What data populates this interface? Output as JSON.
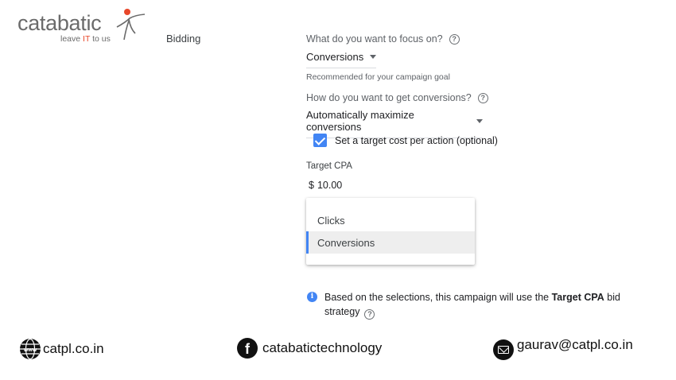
{
  "logo": {
    "word": "catabatic",
    "tagline_pre": "leave ",
    "tagline_it": "IT",
    "tagline_post": " to us"
  },
  "section": {
    "label": "Bidding"
  },
  "focus": {
    "question": "What do you want to focus on?",
    "value": "Conversions",
    "hint": "Recommended for your campaign goal"
  },
  "conversions": {
    "question": "How do you want to get conversions?",
    "value": "Automatically maximize conversions"
  },
  "target_checkbox": {
    "label": "Set a target cost per action (optional)",
    "checked": true
  },
  "target_cpa": {
    "label": "Target CPA",
    "currency": "$",
    "value": "10.00"
  },
  "dropdown": {
    "options": [
      "Clicks",
      "Conversions"
    ],
    "selected": "Conversions"
  },
  "info": {
    "text_pre": "Based on the selections, this campaign will use the ",
    "text_bold": "Target CPA",
    "text_post": " bid strategy"
  },
  "footer": {
    "website": "catpl.co.in",
    "facebook": "catabatictechnology",
    "email": "gaurav@catpl.co.in"
  },
  "colors": {
    "accent": "#4285f4",
    "logo_orange": "#e8472a"
  },
  "icons": [
    "help-icon",
    "caret-down-icon",
    "checkbox-icon",
    "info-icon",
    "globe-icon",
    "facebook-icon",
    "mail-icon"
  ]
}
